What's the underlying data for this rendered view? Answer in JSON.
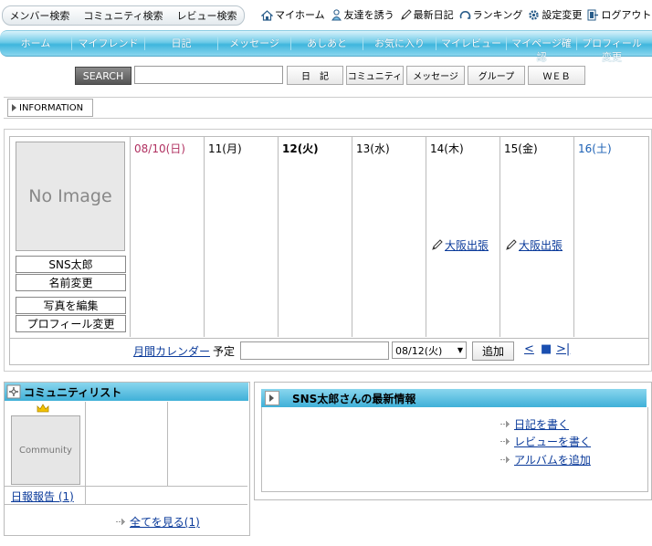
{
  "top_search": [
    "メンバー検索",
    "コミュニティ検索",
    "レビュー検索"
  ],
  "top_links": [
    {
      "label": "マイホーム",
      "icon": "home-icon"
    },
    {
      "label": "友達を誘う",
      "icon": "invite-friend-icon"
    },
    {
      "label": "最新日記",
      "icon": "pencil-icon"
    },
    {
      "label": "ランキング",
      "icon": "ranking-icon"
    },
    {
      "label": "設定変更",
      "icon": "gear-icon"
    },
    {
      "label": "ログアウト",
      "icon": "logout-icon"
    }
  ],
  "nav": [
    "ホーム",
    "マイフレンド",
    "日記",
    "メッセージ",
    "あしあと",
    "お気に入り",
    "マイレビュー",
    "マイページ確認",
    "プロフィール変更"
  ],
  "search": {
    "button": "SEARCH",
    "targets": [
      "日　記",
      "コミュニティ",
      "メッセージ",
      "グループ",
      "ＷＥＢ"
    ]
  },
  "information_tab": "INFORMATION",
  "profile": {
    "no_image": "No Image",
    "name": "SNS太郎",
    "buttons": [
      "名前変更",
      "写真を編集",
      "プロフィール変更"
    ]
  },
  "calendar": {
    "days": [
      {
        "label": "08/10(日)",
        "color": "#b03060",
        "bold": false,
        "event": ""
      },
      {
        "label": "11(月)",
        "color": "#000000",
        "bold": false,
        "event": ""
      },
      {
        "label": "12(火)",
        "color": "#000000",
        "bold": true,
        "event": ""
      },
      {
        "label": "13(水)",
        "color": "#000000",
        "bold": false,
        "event": ""
      },
      {
        "label": "14(木)",
        "color": "#000000",
        "bold": false,
        "event": "大阪出張"
      },
      {
        "label": "15(金)",
        "color": "#000000",
        "bold": false,
        "event": "大阪出張"
      },
      {
        "label": "16(土)",
        "color": "#1a5fb4",
        "bold": false,
        "event": ""
      }
    ],
    "monthly_link": "月間カレンダー",
    "plan_label": "予定",
    "selected_date": "08/12(火)",
    "add_button": "追加",
    "nav_prev": "<",
    "nav_today": "■",
    "nav_next": ">|"
  },
  "community": {
    "title": "コミュニティリスト",
    "thumb_label": "Community",
    "item": "日報報告 (1)",
    "see_all": "全てを見る(1)"
  },
  "latest": {
    "title": "SNS太郎さんの最新情報",
    "links": [
      "日記を書く",
      "レビューを書く",
      "アルバムを追加"
    ]
  }
}
